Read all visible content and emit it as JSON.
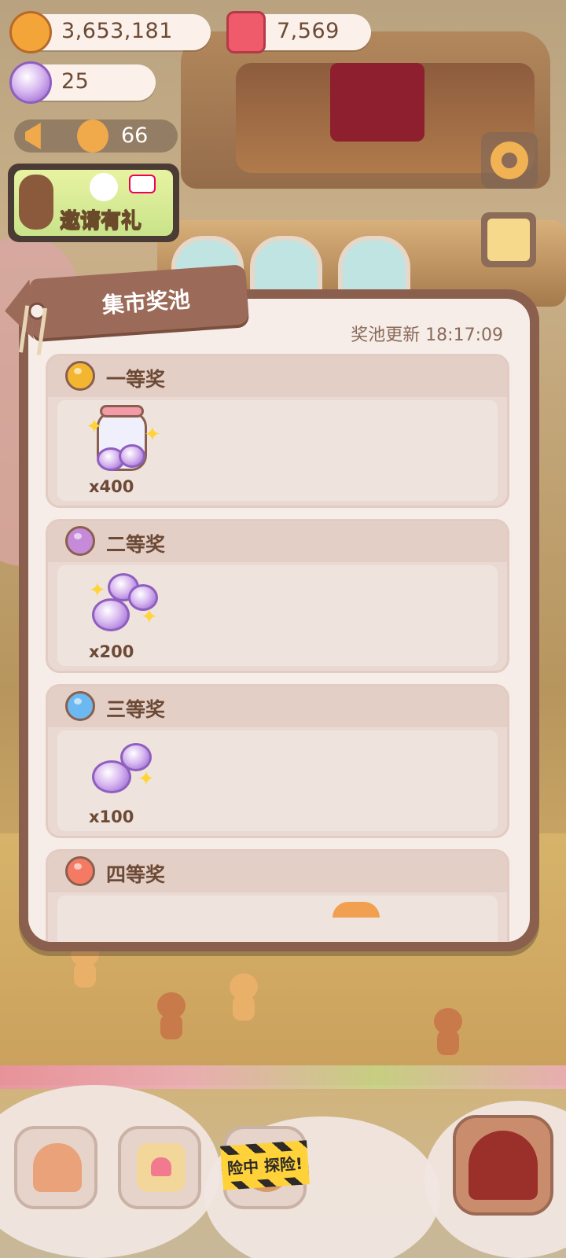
{
  "hud": {
    "cookies": "3,653,181",
    "candle": "7,569",
    "candy": "25",
    "horn_count": "66"
  },
  "invite_label": "邀请有礼",
  "modal": {
    "title": "集市奖池",
    "refresh_text": "奖池更新 18:17:09",
    "prizes": [
      {
        "name": "一等奖",
        "qty": "x400",
        "ball_color": "#f2b630",
        "item": "candy-jar-icon"
      },
      {
        "name": "二等奖",
        "qty": "x200",
        "ball_color": "#c58ad8",
        "item": "candy-pile-icon"
      },
      {
        "name": "三等奖",
        "qty": "x100",
        "ball_color": "#6bb9f0",
        "item": "candy-pair-icon"
      },
      {
        "name": "四等奖",
        "ball_color": "#f47a63"
      }
    ]
  },
  "bottom": {
    "tape_text": "险中 探险!"
  }
}
